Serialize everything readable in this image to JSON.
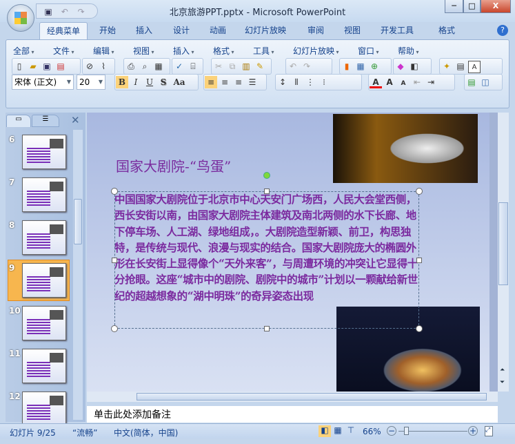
{
  "window": {
    "title": "北京旅游PPT.pptx - Microsoft PowerPoint",
    "minimize": "─",
    "maximize": "□",
    "close": "X"
  },
  "tabs": [
    "经典菜单",
    "开始",
    "插入",
    "设计",
    "动画",
    "幻灯片放映",
    "审阅",
    "视图",
    "开发工具",
    "格式"
  ],
  "menus": [
    "全部",
    "文件",
    "编辑",
    "视图",
    "插入",
    "格式",
    "工具",
    "幻灯片放映",
    "窗口",
    "帮助"
  ],
  "font": {
    "name": "宋体 (正文)",
    "size": "20"
  },
  "format_buttons": {
    "bold": "B",
    "italic": "I",
    "underline": "U",
    "shadow": "S",
    "case": "Aa"
  },
  "thumbnails": [
    {
      "num": "6"
    },
    {
      "num": "7"
    },
    {
      "num": "8"
    },
    {
      "num": "9"
    },
    {
      "num": "10"
    },
    {
      "num": "11"
    },
    {
      "num": "12"
    }
  ],
  "slide": {
    "title": "国家大剧院-“鸟蛋”",
    "body": "中国国家大剧院位于北京市中心天安门广场西，人民大会堂西侧，西长安街以南，由国家大剧院主体建筑及南北两侧的水下长廊、地下停车场、人工湖、绿地组成，。大剧院造型新颖、前卫，构思独特，是传统与现代、浪漫与现实的结合。国家大剧院庞大的椭圆外形在长安街上显得像个“天外来客”，与周遭环境的冲突让它显得十分抢眼。这座“城市中的剧院、剧院中的城市”计划以一颗献给新世纪的超越想象的“湖中明珠”的奇异姿态出现"
  },
  "notes_placeholder": "单击此处添加备注",
  "status": {
    "slide": "幻灯片 9/25",
    "theme": "“流畅”",
    "language": "中文(简体，中国)",
    "zoom": "66%"
  },
  "zoom_percent": 66
}
